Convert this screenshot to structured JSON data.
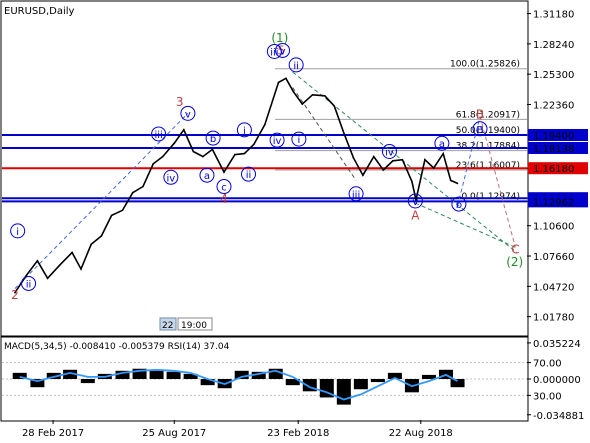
{
  "window": {
    "title": "EURUSD,Daily"
  },
  "chart_data": [
    {
      "type": "line",
      "subtype": "price-line-with-elliott-wave-annotations",
      "title": "EURUSD,Daily",
      "symbol": "EURUSD",
      "timeframe": "Daily",
      "y_axis": {
        "ticks": [
          "1.31180",
          "1.28240",
          "1.25300",
          "1.22360",
          "1.19400",
          "1.18138",
          "1.16180",
          "1.13270",
          "1.12962",
          "1.10600",
          "1.07660",
          "1.04720",
          "1.01780"
        ],
        "ylim": [
          1.0,
          1.323
        ]
      },
      "x_axis": {
        "ticks": [
          "28 Feb 2017",
          "25 Aug 2017",
          "23 Feb 2018",
          "22 Aug 2018"
        ]
      },
      "series": [
        {
          "color": "#000000",
          "x": [
            "2017-01-03",
            "2017-01-20",
            "2017-02-05",
            "2017-02-20",
            "2017-03-10",
            "2017-03-28",
            "2017-04-10",
            "2017-04-25",
            "2017-05-10",
            "2017-05-25",
            "2017-06-10",
            "2017-06-25",
            "2017-07-10",
            "2017-07-25",
            "2017-08-08",
            "2017-08-25",
            "2017-09-08",
            "2017-09-22",
            "2017-10-06",
            "2017-10-20",
            "2017-11-06",
            "2017-11-22",
            "2017-12-06",
            "2017-12-20",
            "2018-01-05",
            "2018-01-25",
            "2018-02-05",
            "2018-02-16",
            "2018-03-01",
            "2018-03-16",
            "2018-04-03",
            "2018-04-17",
            "2018-05-01",
            "2018-05-15",
            "2018-05-29",
            "2018-06-14",
            "2018-06-28",
            "2018-07-12",
            "2018-07-26",
            "2018-08-09",
            "2018-08-15",
            "2018-08-28",
            "2018-09-10",
            "2018-09-24",
            "2018-10-05",
            "2018-10-15"
          ],
          "y": [
            1.041,
            1.058,
            1.072,
            1.055,
            1.068,
            1.08,
            1.064,
            1.088,
            1.096,
            1.116,
            1.121,
            1.138,
            1.144,
            1.166,
            1.173,
            1.186,
            1.199,
            1.178,
            1.173,
            1.18,
            1.158,
            1.175,
            1.176,
            1.185,
            1.204,
            1.245,
            1.249,
            1.236,
            1.224,
            1.233,
            1.232,
            1.222,
            1.196,
            1.172,
            1.155,
            1.173,
            1.16,
            1.169,
            1.17,
            1.149,
            1.131,
            1.17,
            1.162,
            1.176,
            1.15,
            1.147
          ]
        }
      ],
      "horizontal_levels": [
        {
          "value": 1.194,
          "color": "#0000cc",
          "label": "1.19400"
        },
        {
          "value": 1.18138,
          "color": "#0000cc",
          "label": "1.18138"
        },
        {
          "value": 1.1618,
          "color": "#e00000",
          "label": "1.16180"
        },
        {
          "value": 1.1327,
          "color": "#0000cc",
          "label": "1.13270"
        },
        {
          "value": 1.12962,
          "color": "#0000cc",
          "label": "1.12962"
        }
      ],
      "fibonacci_levels": [
        {
          "label": "100.0(1.25826)",
          "value": 1.25826
        },
        {
          "label": "61.8(1.20917)",
          "value": 1.20917
        },
        {
          "label": "50.0(1.19400)",
          "value": 1.194
        },
        {
          "label": "38.2(1.17884)",
          "value": 1.17884
        },
        {
          "label": "23.6(1.16007)",
          "value": 1.16007
        },
        {
          "label": "0.0(1.12974)",
          "value": 1.12974
        }
      ],
      "wave_labels": [
        {
          "text": "(1)",
          "x": "2018-01-27",
          "y": 1.288,
          "color": "#228b22"
        },
        {
          "text": "5",
          "x": "2018-01-29",
          "y": 1.276,
          "color": "#c04040"
        },
        {
          "text": "3",
          "x": "2017-09-02",
          "y": 1.226,
          "color": "#c04040"
        },
        {
          "text": "4",
          "x": "2017-11-06",
          "y": 1.132,
          "color": "#c04040"
        },
        {
          "text": "2",
          "x": "2017-01-03",
          "y": 1.039,
          "color": "#c04040"
        },
        {
          "text": "A",
          "x": "2018-08-14",
          "y": 1.116,
          "color": "#c04040"
        },
        {
          "text": "B",
          "x": "2018-11-17",
          "y": 1.214,
          "color": "#c04040"
        },
        {
          "text": "C",
          "x": "2019-01-08",
          "y": 1.083,
          "color": "#c04040"
        },
        {
          "text": "(2)",
          "x": "2019-01-07",
          "y": 1.071,
          "color": "#228b22"
        },
        {
          "text": "i",
          "x": "2017-01-07",
          "y": 1.101,
          "color": "#0000dd"
        },
        {
          "text": "ii",
          "x": "2017-01-23",
          "y": 1.05,
          "color": "#0000dd"
        },
        {
          "text": "iii",
          "x": "2017-08-02",
          "y": 1.195,
          "color": "#0000dd"
        },
        {
          "text": "iv",
          "x": "2017-08-20",
          "y": 1.153,
          "color": "#0000dd"
        },
        {
          "text": "v",
          "x": "2017-09-14",
          "y": 1.215,
          "color": "#0000dd"
        },
        {
          "text": "a",
          "x": "2017-10-12",
          "y": 1.155,
          "color": "#0000dd"
        },
        {
          "text": "b",
          "x": "2017-10-21",
          "y": 1.191,
          "color": "#0000dd"
        },
        {
          "text": "c",
          "x": "2017-11-06",
          "y": 1.144,
          "color": "#0000dd"
        },
        {
          "text": "i",
          "x": "2017-12-06",
          "y": 1.199,
          "color": "#0000dd"
        },
        {
          "text": "ii",
          "x": "2017-12-12",
          "y": 1.156,
          "color": "#0000dd"
        },
        {
          "text": "iii",
          "x": "2018-01-19",
          "y": 1.275,
          "color": "#0000dd"
        },
        {
          "text": "iv",
          "x": "2018-01-23",
          "y": 1.189,
          "color": "#0000dd"
        },
        {
          "text": "v",
          "x": "2018-01-31",
          "y": 1.276,
          "color": "#0000dd"
        },
        {
          "text": "ii",
          "x": "2018-02-20",
          "y": 1.262,
          "color": "#0000dd"
        },
        {
          "text": "i",
          "x": "2018-02-24",
          "y": 1.19,
          "color": "#0000dd"
        },
        {
          "text": "iii",
          "x": "2018-05-19",
          "y": 1.137,
          "color": "#0000dd"
        },
        {
          "text": "iv",
          "x": "2018-07-07",
          "y": 1.178,
          "color": "#0000dd"
        },
        {
          "text": "v",
          "x": "2018-08-14",
          "y": 1.13,
          "color": "#0000dd"
        },
        {
          "text": "a",
          "x": "2018-09-22",
          "y": 1.186,
          "color": "#0000dd"
        },
        {
          "text": "b",
          "x": "2018-10-17",
          "y": 1.127,
          "color": "#0000dd"
        },
        {
          "text": "B",
          "x": "2018-11-17",
          "y": 1.2,
          "color": "#0000dd"
        }
      ],
      "x_label_badges": [
        "22",
        "19:00"
      ]
    },
    {
      "type": "line",
      "subtype": "oscillator-histogram",
      "title": "MACD(5,34,5) -0.008410 -0.005379 RSI(14) 37.04",
      "indicator_label": "MACD(5,34,5) -0.008410 -0.005379 RSI(14) 37.04",
      "y_axis": {
        "ticks": [
          "0.035224",
          "70.00",
          "0.000000",
          "30.00",
          "-0.034881"
        ],
        "ylim": [
          -0.04,
          0.04
        ]
      },
      "histogram": {
        "color": "#000000",
        "x": [
          "2017-01-10",
          "2017-02-05",
          "2017-03-01",
          "2017-03-25",
          "2017-04-20",
          "2017-05-15",
          "2017-06-10",
          "2017-07-05",
          "2017-07-30",
          "2017-08-24",
          "2017-09-18",
          "2017-10-13",
          "2017-11-07",
          "2017-12-02",
          "2017-12-27",
          "2018-01-21",
          "2018-02-15",
          "2018-03-12",
          "2018-04-06",
          "2018-05-01",
          "2018-05-26",
          "2018-06-20",
          "2018-07-15",
          "2018-08-09",
          "2018-09-03",
          "2018-09-28",
          "2018-10-15"
        ],
        "values": [
          0.006,
          -0.008,
          0.006,
          0.009,
          -0.004,
          0.005,
          0.008,
          0.01,
          0.008,
          0.007,
          0.005,
          -0.006,
          -0.009,
          0.008,
          0.007,
          0.01,
          -0.006,
          -0.012,
          -0.018,
          -0.025,
          -0.01,
          -0.003,
          0.006,
          -0.013,
          0.004,
          0.009,
          -0.008
        ]
      },
      "signal_series": {
        "color": "#3399ff",
        "x": [
          "2017-01-10",
          "2017-02-05",
          "2017-03-01",
          "2017-03-25",
          "2017-04-20",
          "2017-05-15",
          "2017-06-10",
          "2017-07-05",
          "2017-07-30",
          "2017-08-24",
          "2017-09-18",
          "2017-10-13",
          "2017-11-07",
          "2017-12-02",
          "2017-12-27",
          "2018-01-21",
          "2018-02-15",
          "2018-03-12",
          "2018-04-06",
          "2018-05-01",
          "2018-05-26",
          "2018-06-20",
          "2018-07-15",
          "2018-08-09",
          "2018-09-03",
          "2018-09-28",
          "2018-10-15"
        ],
        "values": [
          0.002,
          -0.002,
          0.002,
          0.006,
          0.002,
          0.002,
          0.006,
          0.008,
          0.009,
          0.008,
          0.006,
          0.0,
          -0.005,
          0.002,
          0.005,
          0.008,
          0.002,
          -0.008,
          -0.013,
          -0.02,
          -0.015,
          -0.007,
          0.001,
          -0.007,
          -0.002,
          0.004,
          -0.002
        ]
      }
    }
  ]
}
